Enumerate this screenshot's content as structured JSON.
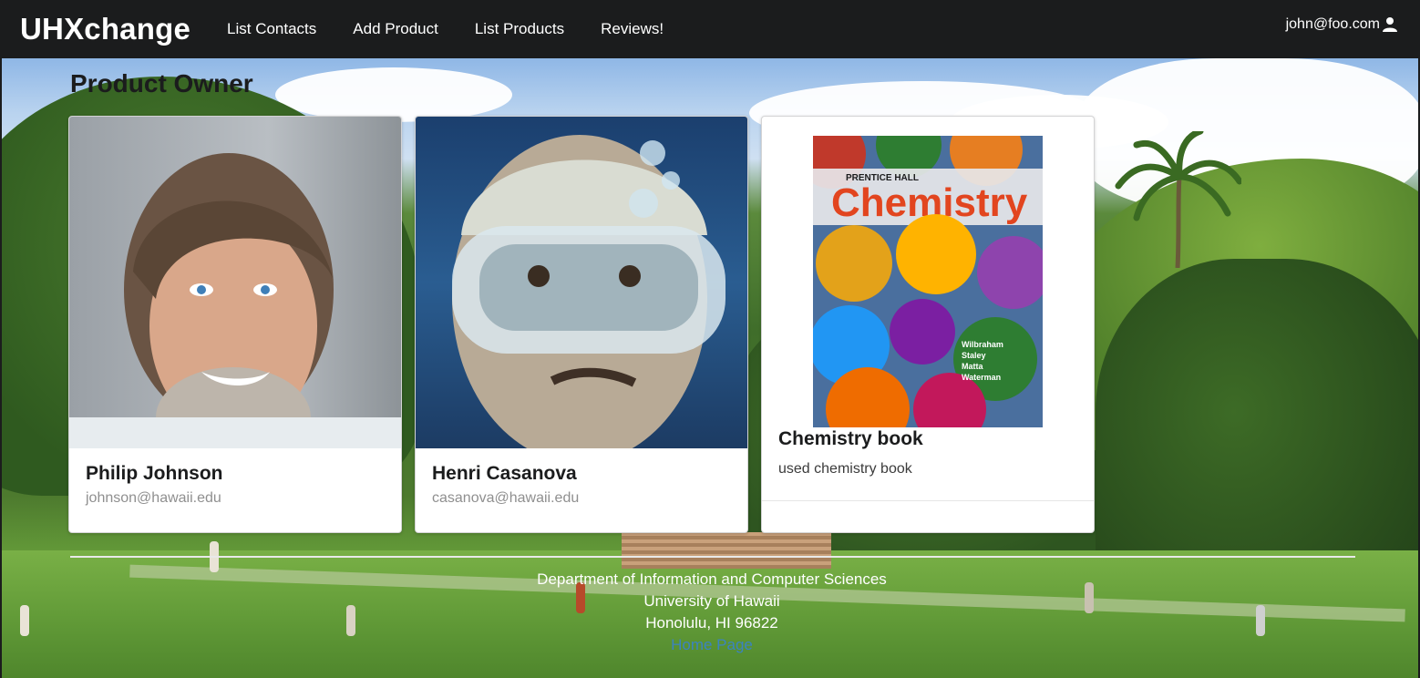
{
  "navbar": {
    "brand": "UHXchange",
    "items": [
      {
        "label": "List Contacts"
      },
      {
        "label": "Add Product"
      },
      {
        "label": "List Products"
      },
      {
        "label": "Reviews!"
      }
    ],
    "user_email": "john@foo.com",
    "user_icon": "user-icon"
  },
  "main": {
    "section_title": "Product Owner",
    "cards": [
      {
        "name": "Philip Johnson",
        "email": "johnson@hawaii.edu",
        "image": "portrait-photo"
      },
      {
        "name": "Henri Casanova",
        "email": "casanova@hawaii.edu",
        "image": "diver-portrait-photo"
      },
      {
        "title": "Chemistry book",
        "description": "used chemistry book",
        "image": "book-cover-photo",
        "cover": {
          "publisher": "PRENTICE HALL",
          "title": "Chemistry",
          "authors": [
            "Wilbraham",
            "Staley",
            "Matta",
            "Waterman"
          ]
        }
      }
    ]
  },
  "footer": {
    "line1": "Department of Information and Computer Sciences",
    "line2": "University of Hawaii",
    "line3": "Honolulu, HI 96822",
    "link": "Home Page"
  },
  "colors": {
    "navbar_bg": "#1b1c1d",
    "link": "#3b83c0",
    "card_bg": "#ffffff"
  }
}
